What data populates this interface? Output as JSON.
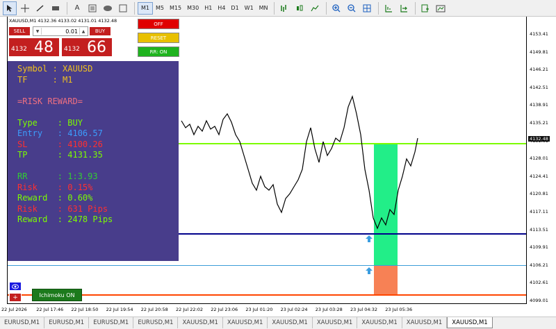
{
  "toolbar": {
    "tool_icons": [
      "cursor-icon",
      "crosshair-icon",
      "line-icon",
      "rectangle-icon",
      "text-icon"
    ],
    "timeframes": [
      "M1",
      "M5",
      "M15",
      "M30",
      "H1",
      "H4",
      "D1",
      "W1",
      "MN"
    ],
    "active_timeframe": "M1"
  },
  "chart": {
    "title": "XAUUSD,M1  4132.36 4133.02 4131.01 4132.48",
    "current_price": "4132.48",
    "price_labels": [
      "4153.41",
      "4149.81",
      "4146.21",
      "4142.51",
      "4138.91",
      "4135.21",
      "4131.61",
      "4128.01",
      "4124.41",
      "4120.81",
      "4117.11",
      "4113.51",
      "4109.91",
      "4106.21",
      "4102.61",
      "4099.01"
    ],
    "time_labels": [
      "22 Jul 2026",
      "22 Jul 17:46",
      "22 Jul 18:50",
      "22 Jul 19:54",
      "22 Jul 20:58",
      "22 Jul 22:02",
      "22 Jul 23:06",
      "23 Jul 01:20",
      "23 Jul 02:24",
      "23 Jul 03:28",
      "23 Jul 04:32",
      "23 Jul 05:36"
    ],
    "colors": {
      "entry_line": "#00008b",
      "sl_line": "#ff4500",
      "tp_line": "#7cfc00",
      "current_line": "#3c9dd8",
      "tp_zone": "#22ee88",
      "sl_zone": "#f78155",
      "arrow": "#3a9de0"
    }
  },
  "trade_panel": {
    "sell_label": "SELL",
    "buy_label": "BUY",
    "lot": "0.01",
    "sell_price_prefix": "4132",
    "sell_price_big": "48",
    "buy_price_prefix": "4132",
    "buy_price_big": "66"
  },
  "controls": {
    "off_label": "OFF",
    "reset_label": "RESET",
    "rr_label": "RR: ON",
    "ichimoku_label": "Ichimoku ON",
    "plus_label": "+"
  },
  "info": {
    "lines": [
      {
        "text": "Symbol : XAUUSD",
        "color": "#f0c020"
      },
      {
        "text": "TF     : M1",
        "color": "#f0c020"
      },
      {
        "text": "",
        "color": "#ffffff"
      },
      {
        "text": "=RISK REWARD=",
        "color": "#f07080"
      },
      {
        "text": "",
        "color": "#ffffff"
      },
      {
        "text": "Type    : BUY",
        "color": "#7cfc00"
      },
      {
        "text": "Entry   : 4106.57",
        "color": "#3c9dfc"
      },
      {
        "text": "SL      : 4100.26",
        "color": "#ff3030"
      },
      {
        "text": "TP      : 4131.35",
        "color": "#7cfc00"
      },
      {
        "text": "",
        "color": "#ffffff"
      },
      {
        "text": "RR      : 1:3.93",
        "color": "#32cd32"
      },
      {
        "text": "Risk    : 0.15%",
        "color": "#ff3030"
      },
      {
        "text": "Reward  : 0.60%",
        "color": "#7cfc00"
      },
      {
        "text": "Risk    : 631 Pips",
        "color": "#ff3030"
      },
      {
        "text": "Reward  : 2478 Pips",
        "color": "#7cfc00"
      }
    ]
  },
  "tabs": [
    "EURUSD,M1",
    "EURUSD,M1",
    "EURUSD,M1",
    "EURUSD,M1",
    "XAUUSD,M1",
    "XAUUSD,M1",
    "XAUUSD,M1",
    "XAUUSD,M1",
    "XAUUSD,M1",
    "XAUUSD,M1",
    "XAUUSD,M1"
  ],
  "active_tab": 10
}
